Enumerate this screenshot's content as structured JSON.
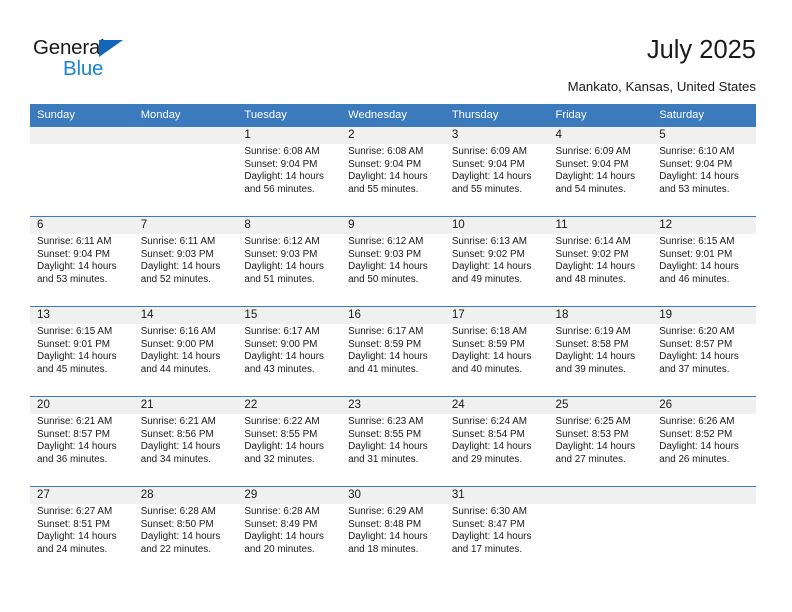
{
  "logo": {
    "word_top": "General",
    "word_bottom": "Blue",
    "triangle_icon": "triangle-icon",
    "color_black": "#1a1a1a",
    "color_blue": "#1a84d6",
    "color_triangle": "#1565b8"
  },
  "header": {
    "month_title": "July 2025",
    "location": "Mankato, Kansas, United States"
  },
  "theme": {
    "header_blue": "#3a7abd",
    "number_band_gray": "#f0f0f0",
    "text": "#1a1a1a"
  },
  "calendar": {
    "weekdays": [
      "Sunday",
      "Monday",
      "Tuesday",
      "Wednesday",
      "Thursday",
      "Friday",
      "Saturday"
    ],
    "weeks": [
      {
        "numbers": [
          "",
          "",
          "1",
          "2",
          "3",
          "4",
          "5"
        ],
        "cells": [
          {
            "empty": true
          },
          {
            "empty": true
          },
          {
            "sunrise": "Sunrise: 6:08 AM",
            "sunset": "Sunset: 9:04 PM",
            "daylight1": "Daylight: 14 hours",
            "daylight2": "and 56 minutes."
          },
          {
            "sunrise": "Sunrise: 6:08 AM",
            "sunset": "Sunset: 9:04 PM",
            "daylight1": "Daylight: 14 hours",
            "daylight2": "and 55 minutes."
          },
          {
            "sunrise": "Sunrise: 6:09 AM",
            "sunset": "Sunset: 9:04 PM",
            "daylight1": "Daylight: 14 hours",
            "daylight2": "and 55 minutes."
          },
          {
            "sunrise": "Sunrise: 6:09 AM",
            "sunset": "Sunset: 9:04 PM",
            "daylight1": "Daylight: 14 hours",
            "daylight2": "and 54 minutes."
          },
          {
            "sunrise": "Sunrise: 6:10 AM",
            "sunset": "Sunset: 9:04 PM",
            "daylight1": "Daylight: 14 hours",
            "daylight2": "and 53 minutes."
          }
        ]
      },
      {
        "numbers": [
          "6",
          "7",
          "8",
          "9",
          "10",
          "11",
          "12"
        ],
        "cells": [
          {
            "sunrise": "Sunrise: 6:11 AM",
            "sunset": "Sunset: 9:04 PM",
            "daylight1": "Daylight: 14 hours",
            "daylight2": "and 53 minutes."
          },
          {
            "sunrise": "Sunrise: 6:11 AM",
            "sunset": "Sunset: 9:03 PM",
            "daylight1": "Daylight: 14 hours",
            "daylight2": "and 52 minutes."
          },
          {
            "sunrise": "Sunrise: 6:12 AM",
            "sunset": "Sunset: 9:03 PM",
            "daylight1": "Daylight: 14 hours",
            "daylight2": "and 51 minutes."
          },
          {
            "sunrise": "Sunrise: 6:12 AM",
            "sunset": "Sunset: 9:03 PM",
            "daylight1": "Daylight: 14 hours",
            "daylight2": "and 50 minutes."
          },
          {
            "sunrise": "Sunrise: 6:13 AM",
            "sunset": "Sunset: 9:02 PM",
            "daylight1": "Daylight: 14 hours",
            "daylight2": "and 49 minutes."
          },
          {
            "sunrise": "Sunrise: 6:14 AM",
            "sunset": "Sunset: 9:02 PM",
            "daylight1": "Daylight: 14 hours",
            "daylight2": "and 48 minutes."
          },
          {
            "sunrise": "Sunrise: 6:15 AM",
            "sunset": "Sunset: 9:01 PM",
            "daylight1": "Daylight: 14 hours",
            "daylight2": "and 46 minutes."
          }
        ]
      },
      {
        "numbers": [
          "13",
          "14",
          "15",
          "16",
          "17",
          "18",
          "19"
        ],
        "cells": [
          {
            "sunrise": "Sunrise: 6:15 AM",
            "sunset": "Sunset: 9:01 PM",
            "daylight1": "Daylight: 14 hours",
            "daylight2": "and 45 minutes."
          },
          {
            "sunrise": "Sunrise: 6:16 AM",
            "sunset": "Sunset: 9:00 PM",
            "daylight1": "Daylight: 14 hours",
            "daylight2": "and 44 minutes."
          },
          {
            "sunrise": "Sunrise: 6:17 AM",
            "sunset": "Sunset: 9:00 PM",
            "daylight1": "Daylight: 14 hours",
            "daylight2": "and 43 minutes."
          },
          {
            "sunrise": "Sunrise: 6:17 AM",
            "sunset": "Sunset: 8:59 PM",
            "daylight1": "Daylight: 14 hours",
            "daylight2": "and 41 minutes."
          },
          {
            "sunrise": "Sunrise: 6:18 AM",
            "sunset": "Sunset: 8:59 PM",
            "daylight1": "Daylight: 14 hours",
            "daylight2": "and 40 minutes."
          },
          {
            "sunrise": "Sunrise: 6:19 AM",
            "sunset": "Sunset: 8:58 PM",
            "daylight1": "Daylight: 14 hours",
            "daylight2": "and 39 minutes."
          },
          {
            "sunrise": "Sunrise: 6:20 AM",
            "sunset": "Sunset: 8:57 PM",
            "daylight1": "Daylight: 14 hours",
            "daylight2": "and 37 minutes."
          }
        ]
      },
      {
        "numbers": [
          "20",
          "21",
          "22",
          "23",
          "24",
          "25",
          "26"
        ],
        "cells": [
          {
            "sunrise": "Sunrise: 6:21 AM",
            "sunset": "Sunset: 8:57 PM",
            "daylight1": "Daylight: 14 hours",
            "daylight2": "and 36 minutes."
          },
          {
            "sunrise": "Sunrise: 6:21 AM",
            "sunset": "Sunset: 8:56 PM",
            "daylight1": "Daylight: 14 hours",
            "daylight2": "and 34 minutes."
          },
          {
            "sunrise": "Sunrise: 6:22 AM",
            "sunset": "Sunset: 8:55 PM",
            "daylight1": "Daylight: 14 hours",
            "daylight2": "and 32 minutes."
          },
          {
            "sunrise": "Sunrise: 6:23 AM",
            "sunset": "Sunset: 8:55 PM",
            "daylight1": "Daylight: 14 hours",
            "daylight2": "and 31 minutes."
          },
          {
            "sunrise": "Sunrise: 6:24 AM",
            "sunset": "Sunset: 8:54 PM",
            "daylight1": "Daylight: 14 hours",
            "daylight2": "and 29 minutes."
          },
          {
            "sunrise": "Sunrise: 6:25 AM",
            "sunset": "Sunset: 8:53 PM",
            "daylight1": "Daylight: 14 hours",
            "daylight2": "and 27 minutes."
          },
          {
            "sunrise": "Sunrise: 6:26 AM",
            "sunset": "Sunset: 8:52 PM",
            "daylight1": "Daylight: 14 hours",
            "daylight2": "and 26 minutes."
          }
        ]
      },
      {
        "numbers": [
          "27",
          "28",
          "29",
          "30",
          "31",
          "",
          ""
        ],
        "cells": [
          {
            "sunrise": "Sunrise: 6:27 AM",
            "sunset": "Sunset: 8:51 PM",
            "daylight1": "Daylight: 14 hours",
            "daylight2": "and 24 minutes."
          },
          {
            "sunrise": "Sunrise: 6:28 AM",
            "sunset": "Sunset: 8:50 PM",
            "daylight1": "Daylight: 14 hours",
            "daylight2": "and 22 minutes."
          },
          {
            "sunrise": "Sunrise: 6:28 AM",
            "sunset": "Sunset: 8:49 PM",
            "daylight1": "Daylight: 14 hours",
            "daylight2": "and 20 minutes."
          },
          {
            "sunrise": "Sunrise: 6:29 AM",
            "sunset": "Sunset: 8:48 PM",
            "daylight1": "Daylight: 14 hours",
            "daylight2": "and 18 minutes."
          },
          {
            "sunrise": "Sunrise: 6:30 AM",
            "sunset": "Sunset: 8:47 PM",
            "daylight1": "Daylight: 14 hours",
            "daylight2": "and 17 minutes."
          },
          {
            "empty": true
          },
          {
            "empty": true
          }
        ]
      }
    ]
  }
}
